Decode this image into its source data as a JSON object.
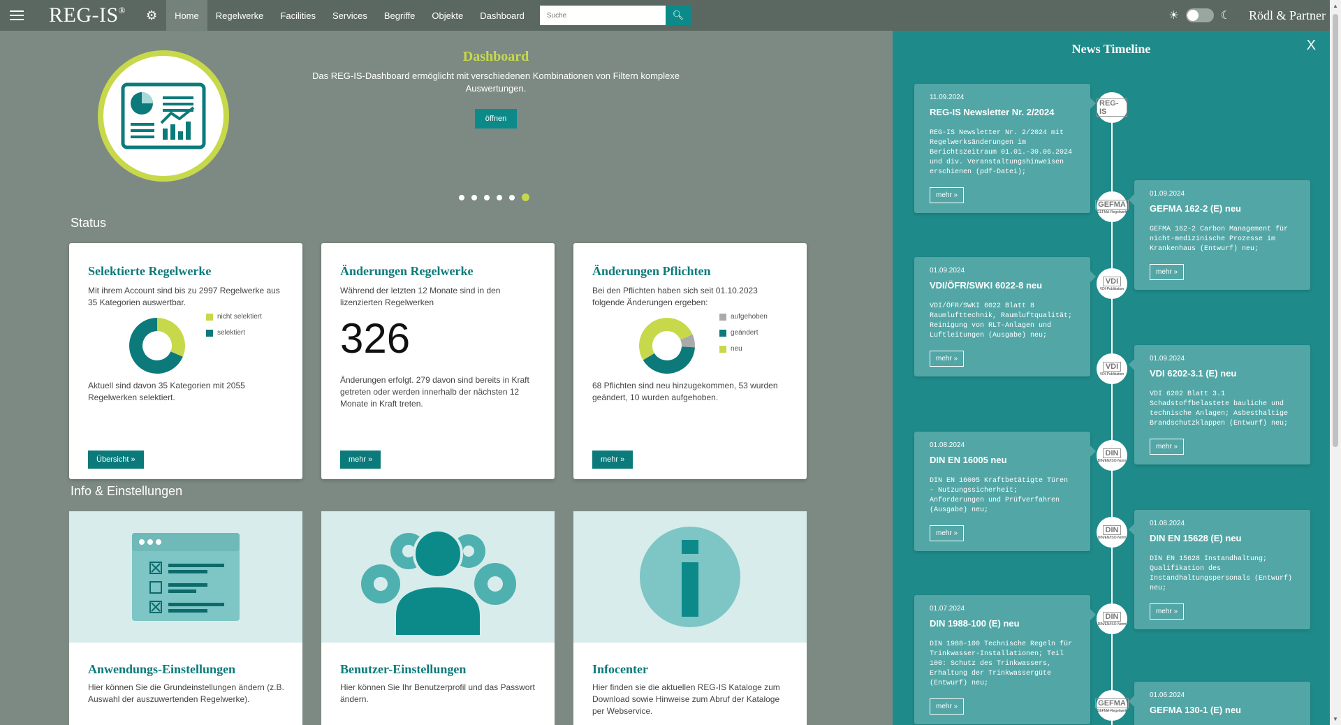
{
  "topbar": {
    "logo": "REG-IS",
    "logo_mark": "®",
    "nav": [
      "Home",
      "Regelwerke",
      "Facilities",
      "Services",
      "Begriffe",
      "Objekte",
      "Dashboard"
    ],
    "search_placeholder": "Suche",
    "brand": "Rödl & Partner"
  },
  "hero": {
    "title": "Dashboard",
    "text": "Das REG-IS-Dashboard ermöglicht mit verschiedenen Kombinationen von Filtern komplexe Auswertungen.",
    "button": "öffnen",
    "dot_count": 6,
    "active_dot": 5
  },
  "status": {
    "heading": "Status",
    "cards": [
      {
        "title": "Selektierte Regelwerke",
        "desc": "Mit ihrem Account sind bis zu 2997 Regelwerke aus 35 Kategorien auswertbar.",
        "legend": [
          "nicht selektiert",
          "selektiert"
        ],
        "foot": "Aktuell sind davon 35 Kategorien mit 2055 Regelwerken selektiert.",
        "button": "Übersicht »"
      },
      {
        "title": "Änderungen Regelwerke",
        "desc": "Während der letzten 12 Monate sind in den lizenzierten Regelwerken",
        "number": "326",
        "foot": "Änderungen erfolgt. 279 davon sind bereits in Kraft getreten oder werden innerhalb der nächsten 12 Monate in Kraft treten.",
        "button": "mehr »"
      },
      {
        "title": "Änderungen Pflichten",
        "desc": "Bei den Pflichten haben sich seit 01.10.2023 folgende Änderungen ergeben:",
        "legend": [
          "aufgehoben",
          "geändert",
          "neu"
        ],
        "foot": "68 Pflichten sind neu hinzugekommen, 53 wurden geändert, 10 wurden aufgehoben.",
        "button": "mehr »"
      }
    ]
  },
  "info": {
    "heading": "Info & Einstellungen",
    "cards": [
      {
        "title": "Anwendungs-Einstellungen",
        "desc": "Hier können Sie die Grundeinstellungen ändern (z.B. Auswahl der auszuwertenden Regelwerke)."
      },
      {
        "title": "Benutzer-Einstellungen",
        "desc": "Hier können Sie Ihr Benutzerprofil und das Passwort ändern."
      },
      {
        "title": "Infocenter",
        "desc": "Hier finden sie die aktuellen REG-IS Kataloge zum Download sowie Hinweise zum Abruf der Kataloge per Webservice."
      }
    ]
  },
  "chart_data": [
    {
      "type": "pie",
      "categories": [
        "nicht selektiert",
        "selektiert"
      ],
      "values": [
        942,
        2055
      ],
      "colors": [
        "#c7d94a",
        "#0c7a7a"
      ]
    },
    {
      "type": "pie",
      "categories": [
        "aufgehoben",
        "geändert",
        "neu"
      ],
      "values": [
        10,
        53,
        68
      ],
      "colors": [
        "#aaaaaa",
        "#0c7a7a",
        "#c7d94a"
      ]
    }
  ],
  "news": {
    "title": "News Timeline",
    "close": "X",
    "more": "mehr »",
    "items": [
      {
        "date": "11.09.2024",
        "title": "REG-IS Newsletter Nr. 2/2024",
        "body": "REG-IS Newsletter Nr. 2/2024 mit Regelwerksänderungen im Berichtszeitraum 01.01.-30.06.2024 und div. Veranstaltungshinweisen erschienen (pdf-Datei);",
        "logo": "REG-IS",
        "logo_sub": ""
      },
      {
        "date": "01.09.2024",
        "title": "GEFMA 162-2 (E) neu",
        "body": "GEFMA 162-2 Carbon Management für nicht-medizinische Prozesse im Krankenhaus (Entwurf) neu;",
        "logo": "GEFMA",
        "logo_sub": "GEFMA-Regelwerk"
      },
      {
        "date": "01.09.2024",
        "title": "VDI/ÖFR/SWKI 6022-8 neu",
        "body": "VDI/ÖFR/SWKI 6022 Blatt 8 Raumlufttechnik, Raumluftqualität; Reinigung von RLT-Anlagen und Luftleitungen (Ausgabe) neu;",
        "logo": "VDI",
        "logo_sub": "VDI-Publikation"
      },
      {
        "date": "01.09.2024",
        "title": "VDI 6202-3.1 (E) neu",
        "body": "VDI 6202 Blatt 3.1 Schadstoffbelastete bauliche und technische Anlagen; Asbesthaltige Brandschutzklappen (Entwurf) neu;",
        "logo": "VDI",
        "logo_sub": "VDI-Publikation"
      },
      {
        "date": "01.08.2024",
        "title": "DIN EN 16005 neu",
        "body": "DIN EN 16005 Kraftbetätigte Türen - Nutzungssicherheit; Anforderungen und Prüfverfahren (Ausgabe) neu;",
        "logo": "DIN",
        "logo_sub": "DIN/EN/ISO-Norm"
      },
      {
        "date": "01.08.2024",
        "title": "DIN EN 15628 (E) neu",
        "body": "DIN EN 15628 Instandhaltung; Qualifikation des Instandhaltungspersonals (Entwurf) neu;",
        "logo": "DIN",
        "logo_sub": "DIN/EN/ISO-Norm"
      },
      {
        "date": "01.07.2024",
        "title": "DIN 1988-100 (E) neu",
        "body": "DIN 1988-100 Technische Regeln für Trinkwasser-Installationen; Teil 100: Schutz des Trinkwassers, Erhaltung der Trinkwassergüte (Entwurf) neu;",
        "logo": "DIN",
        "logo_sub": "DIN/EN/ISO-Norm"
      },
      {
        "date": "01.06.2024",
        "title": "GEFMA 130-1 (E) neu",
        "body": "",
        "logo": "GEFMA",
        "logo_sub": "GEFMA-Regelwerk"
      }
    ]
  }
}
